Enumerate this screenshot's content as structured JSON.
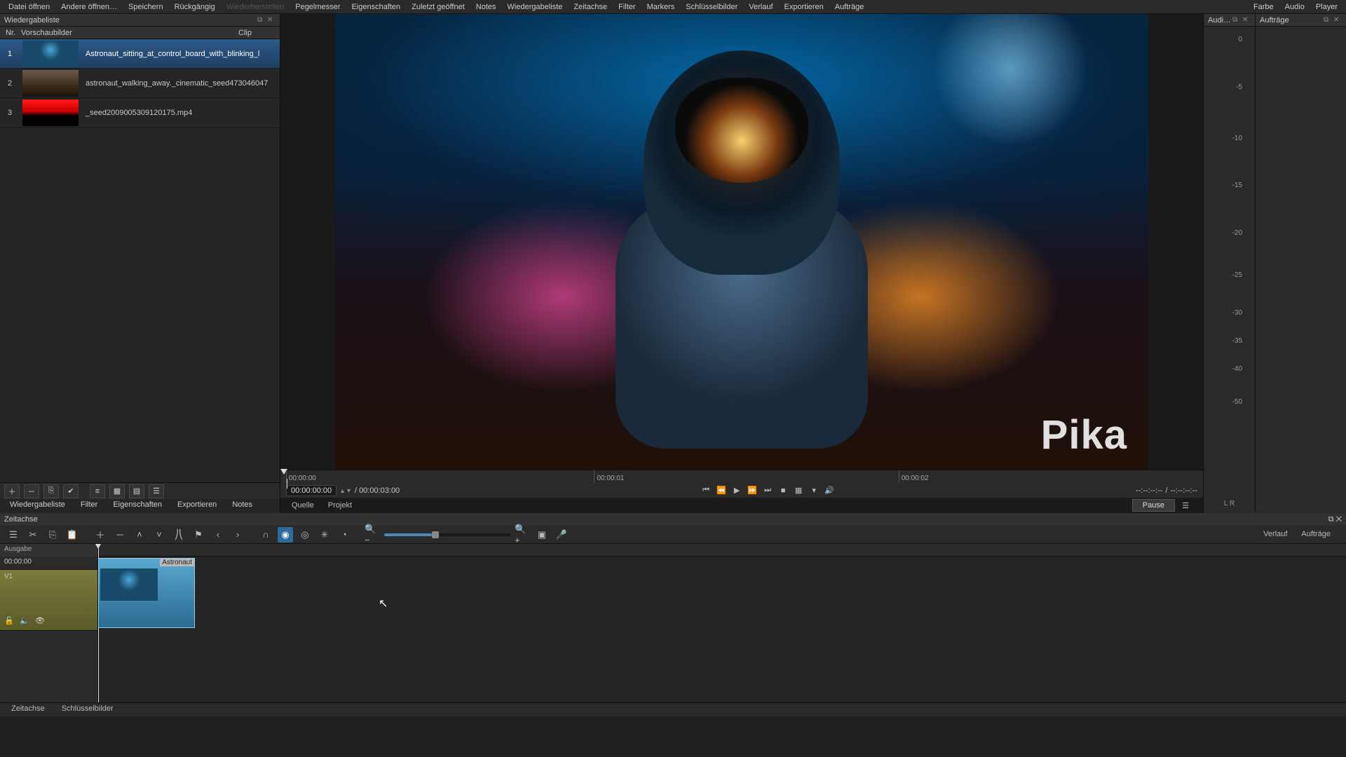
{
  "menu": {
    "items": [
      "Datei öffnen",
      "Andere öffnen…",
      "Speichern",
      "Rückgängig",
      "Wiederherstellen",
      "Pegelmesser",
      "Eigenschaften",
      "Zuletzt geöffnet",
      "Notes",
      "Wiedergabeliste",
      "Zeitachse",
      "Filter",
      "Markers",
      "Schlüsselbilder",
      "Verlauf",
      "Exportieren",
      "Aufträge"
    ],
    "disabled_index": 4,
    "right_items": [
      "Farbe",
      "Audio",
      "Player"
    ]
  },
  "playlist": {
    "title": "Wiedergabeliste",
    "columns": {
      "nr": "Nr.",
      "thumb": "Vorschaubilder",
      "clip": "Clip"
    },
    "rows": [
      {
        "n": "1",
        "name": "Astronaut_sitting_at_control_board_with_blinking_l",
        "thumb": "astro1",
        "selected": true
      },
      {
        "n": "2",
        "name": "astronaut_walking_away._cinematic_seed473046047",
        "thumb": "astro2",
        "selected": false
      },
      {
        "n": "3",
        "name": "_seed2009005309120175.mp4",
        "thumb": "red",
        "selected": false
      }
    ],
    "toolbar_icons": [
      "plus",
      "minus",
      "copy",
      "check",
      "list",
      "grid",
      "detail",
      "menu"
    ],
    "tabs": [
      "Wiedergabeliste",
      "Filter",
      "Eigenschaften",
      "Exportieren",
      "Notes"
    ]
  },
  "preview": {
    "watermark": "Pika",
    "ruler": [
      {
        "pos": 0,
        "label": "00:00:00"
      },
      {
        "pos": 33.3,
        "label": "00:00:01"
      },
      {
        "pos": 66.6,
        "label": "00:00:02"
      }
    ],
    "timecode_current": "00:00:00:00",
    "timecode_total": "/ 00:00:03:00",
    "in_tc": "--:--:--:--",
    "dur_tc": "/",
    "out_tc": "--:--:--:--",
    "source_tab": "Quelle",
    "project_tab": "Projekt"
  },
  "transport_icons": [
    "skip-start",
    "rewind",
    "play",
    "fast-forward",
    "skip-end",
    "stop",
    "grid",
    "volume"
  ],
  "audio": {
    "title": "Audi…",
    "ticks": [
      {
        "v": "0",
        "pct": 2
      },
      {
        "v": "-5",
        "pct": 12
      },
      {
        "v": "-10",
        "pct": 23
      },
      {
        "v": "-15",
        "pct": 33
      },
      {
        "v": "-20",
        "pct": 43
      },
      {
        "v": "-25",
        "pct": 52
      },
      {
        "v": "-30",
        "pct": 60
      },
      {
        "v": "-35",
        "pct": 66
      },
      {
        "v": "-40",
        "pct": 72
      },
      {
        "v": "-50",
        "pct": 79
      }
    ],
    "lr": "L   R"
  },
  "jobs": {
    "title": "Aufträge"
  },
  "right_side": {
    "pause": "Pause",
    "tabs": [
      "Verlauf",
      "Aufträge"
    ]
  },
  "timeline": {
    "title": "Zeitachse",
    "output": "Ausgabe",
    "playhead_tc": "00:00:00",
    "track": "V1",
    "clip_label": "Astronaut",
    "bottom_tabs": [
      "Zeitachse",
      "Schlüsselbilder"
    ],
    "tool_icons": [
      "menu",
      "cut",
      "paste",
      "clipboard",
      "plus",
      "minus",
      "up",
      "down",
      "split",
      "marker",
      "prev",
      "next",
      "magnet",
      "scrub",
      "ripple-all",
      "ripple",
      "record-marker",
      "zoom-out",
      "zoom-in",
      "fit",
      "mic"
    ]
  }
}
